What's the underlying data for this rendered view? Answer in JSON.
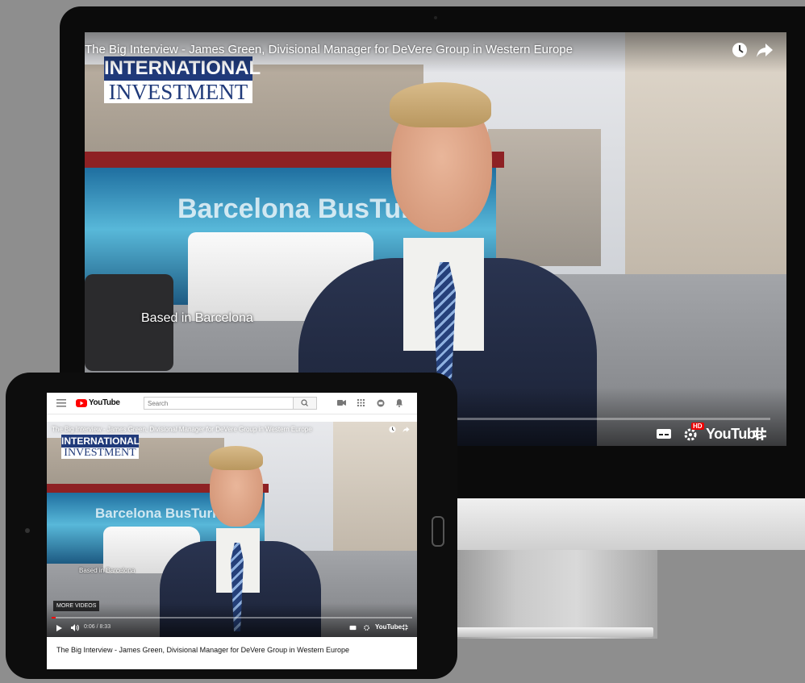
{
  "desktop_player": {
    "title": "The Big Interview - James Green, Divisional Manager for DeVere Group in Western Europe",
    "logo_line1": "INTERNATIONAL",
    "logo_line2": "INVESTMENT",
    "lower_third": "Based in Barcelona",
    "bus_sign": "Barcelona BusTuristic",
    "brand": "YouTube",
    "hd_badge": "HD",
    "icons": [
      "watch-later-icon",
      "share-icon",
      "subtitles-icon",
      "settings-icon",
      "exit-fullscreen-icon"
    ]
  },
  "tablet_page": {
    "brand": "YouTube",
    "search": {
      "placeholder": "Search"
    },
    "icons": [
      "menu-icon",
      "search-icon",
      "upload-icon",
      "apps-icon",
      "messages-icon",
      "notifications-icon"
    ],
    "player": {
      "title": "The Big Interview - James Green, Divisional Manager for DeVere Group in Western Europe",
      "logo_line1": "INTERNATIONAL",
      "logo_line2": "INVESTMENT",
      "lower_third": "Based in Barcelona",
      "bus_sign": "Barcelona BusTuristic",
      "more_videos": "MORE VIDEOS",
      "time": "0:06 / 8:33",
      "progress": 0.012,
      "brand": "YouTube"
    },
    "video_title": "The Big Interview - James Green, Divisional Manager for DeVere Group in Western Europe"
  },
  "colors": {
    "youtube_red": "#ff0000",
    "logo_blue": "#203a7a",
    "progress_red": "#f00"
  }
}
